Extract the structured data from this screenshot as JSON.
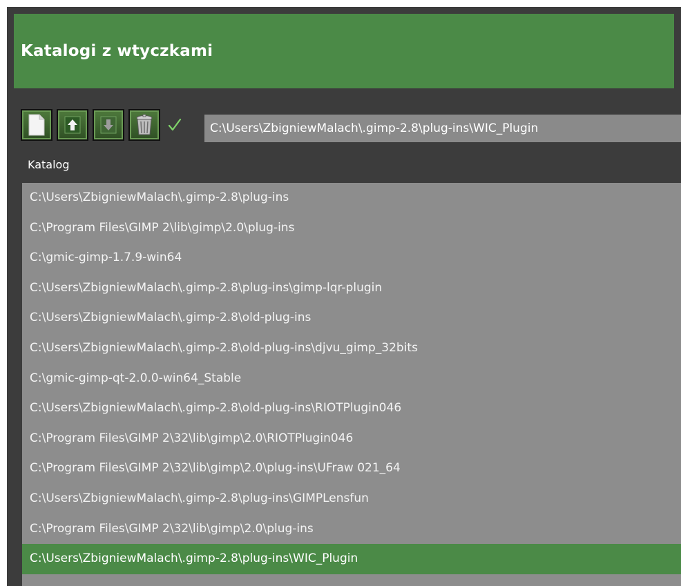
{
  "header": {
    "title": "Katalogi z wtyczkami"
  },
  "toolbar": {
    "buttons": [
      {
        "name": "new-folder-button",
        "icon": "new-document-icon"
      },
      {
        "name": "move-up-button",
        "icon": "arrow-up-icon"
      },
      {
        "name": "move-down-button",
        "icon": "arrow-down-icon"
      },
      {
        "name": "delete-button",
        "icon": "trash-icon"
      }
    ],
    "confirm_icon": "checkmark-icon",
    "path_value": "C:\\Users\\ZbigniewMalach\\.gimp-2.8\\plug-ins\\WIC_Plugin"
  },
  "list": {
    "column_header": "Katalog",
    "items": [
      "C:\\Users\\ZbigniewMalach\\.gimp-2.8\\plug-ins",
      "C:\\Program Files\\GIMP 2\\lib\\gimp\\2.0\\plug-ins",
      "C:\\gmic-gimp-1.7.9-win64",
      "C:\\Users\\ZbigniewMalach\\.gimp-2.8\\plug-ins\\gimp-lqr-plugin",
      "C:\\Users\\ZbigniewMalach\\.gimp-2.8\\old-plug-ins",
      "C:\\Users\\ZbigniewMalach\\.gimp-2.8\\old-plug-ins\\djvu_gimp_32bits",
      "C:\\gmic-gimp-qt-2.0.0-win64_Stable",
      "C:\\Users\\ZbigniewMalach\\.gimp-2.8\\old-plug-ins\\RIOTPlugin046",
      "C:\\Program Files\\GIMP 2\\32\\lib\\gimp\\2.0\\RIOTPlugin046",
      "C:\\Program Files\\GIMP 2\\32\\lib\\gimp\\2.0\\plug-ins\\UFraw 021_64",
      "C:\\Users\\ZbigniewMalach\\.gimp-2.8\\plug-ins\\GIMPLensfun",
      "C:\\Program Files\\GIMP 2\\32\\lib\\gimp\\2.0\\plug-ins",
      "C:\\Users\\ZbigniewMalach\\.gimp-2.8\\plug-ins\\WIC_Plugin"
    ],
    "selected_index": 12
  },
  "colors": {
    "accent_green": "#4b8a47",
    "panel_dark": "#3c3c3c",
    "list_gray": "#8d8d8d",
    "check_green": "#7fd46a"
  }
}
